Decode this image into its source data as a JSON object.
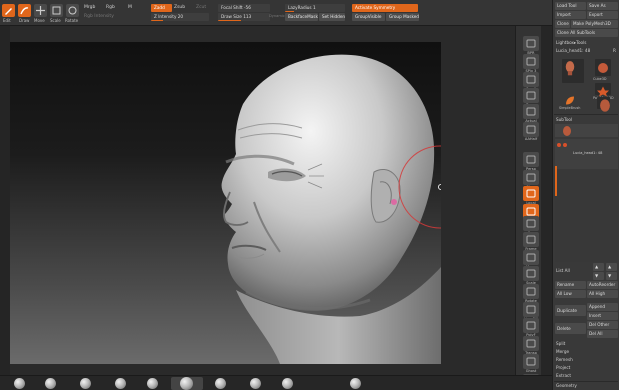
{
  "toolbar": {
    "icons": [
      {
        "name": "edit",
        "label": "Edit",
        "active": true
      },
      {
        "name": "draw",
        "label": "Draw",
        "active": true
      },
      {
        "name": "move",
        "label": "Move",
        "active": false
      },
      {
        "name": "scale",
        "label": "Scale",
        "active": false
      },
      {
        "name": "rotate",
        "label": "Rotate",
        "active": false
      }
    ],
    "mrgb": "Mrgb",
    "rgb": "Rgb",
    "m": "M",
    "rgb_intensity": "Rgb Intensity",
    "zadd": "Zadd",
    "zsub": "Zsub",
    "zcut": "Zcut",
    "z_intensity": "Z Intensity 20",
    "focal_shift": "Focal Shift -56",
    "draw_size": "Draw Size 113",
    "dynamic": "Dynamic",
    "lazy_radius": "LazyRadius 1",
    "backface_mask": "BackfaceMask",
    "set_hidden": "Set Hidden",
    "activate_symmetry": "Activate Symmetry",
    "group_visible": "GroupVisible",
    "group_masked": "Group Masked"
  },
  "shelf": {
    "items": [
      {
        "name": "bpr",
        "label": "BPR"
      },
      {
        "name": "spix",
        "label": "SPix 3"
      },
      {
        "name": "scroll",
        "label": "Scroll"
      },
      {
        "name": "zoom",
        "label": "Zoom"
      },
      {
        "name": "actual",
        "label": "Actual"
      },
      {
        "name": "aahalf",
        "label": "AAHalf"
      },
      {
        "name": "persp",
        "label": "Persp"
      },
      {
        "name": "floor",
        "label": "Floor"
      },
      {
        "name": "local",
        "label": "Local"
      },
      {
        "name": "lsym",
        "label": "L.Sym"
      },
      {
        "name": "xyz",
        "label": "Xyz"
      },
      {
        "name": "frame",
        "label": "Frame"
      },
      {
        "name": "move",
        "label": "Move"
      },
      {
        "name": "scale",
        "label": "Scale"
      },
      {
        "name": "rotate",
        "label": "Rotate"
      },
      {
        "name": "linefill",
        "label": "Line Fill"
      },
      {
        "name": "polyf",
        "label": "PolyF"
      },
      {
        "name": "transp",
        "label": "Transp"
      },
      {
        "name": "ghost",
        "label": "Ghost"
      },
      {
        "name": "solo",
        "label": "Solo"
      }
    ]
  },
  "palette": {
    "load_tool": "Load Tool",
    "save_as": "Save As",
    "import": "Import",
    "export": "Export",
    "clone": "Clone",
    "make_polymesh": "Make PolyMesh3D",
    "clone_all": "Clone All SubTools",
    "lightbox_tools": "Lightbox▸Tools",
    "tool_name": "Lucia_head1: 48",
    "r": "R",
    "thumbs": [
      {
        "name": "head",
        "label": "Lucia_head1"
      },
      {
        "name": "cube",
        "label": "Cube3D"
      },
      {
        "name": "star",
        "label": "PolyMesh3D"
      },
      {
        "name": "simplebrush",
        "label": "SimpleBrush"
      },
      {
        "name": "head2",
        "label": "Lucia_head1"
      }
    ],
    "subtool": "SubTool",
    "subtool_item": "Lucia_head1: 48",
    "list_all": "List All",
    "rename": "Rename",
    "autoreorder": "AutoReorder",
    "all_low": "All Low",
    "all_high": "All High",
    "duplicate": "Duplicate",
    "append": "Append",
    "insert": "Insert",
    "delete": "Delete",
    "del_other": "Del Other",
    "del_all": "Del All",
    "split": "Split",
    "merge": "Merge",
    "remesh": "Remesh",
    "project": "Project",
    "extract": "Extract",
    "geometry": "Geometry"
  },
  "colors": {
    "accent": "#e0661b",
    "panel": "#393939",
    "toolbar": "#353535"
  }
}
